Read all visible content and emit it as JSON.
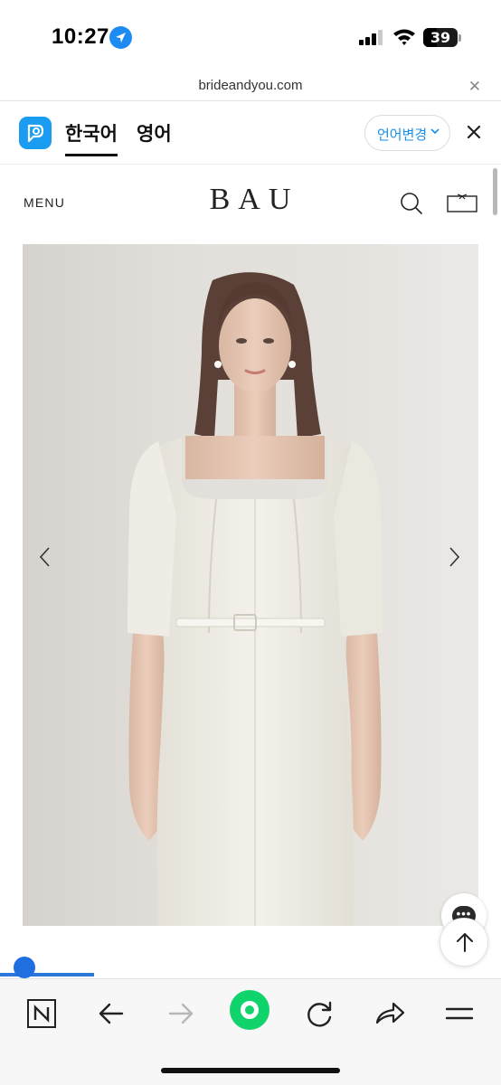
{
  "status_bar": {
    "time": "10:27",
    "battery": "39"
  },
  "browser": {
    "url": "brideandyou.com"
  },
  "translate_bar": {
    "tabs": [
      {
        "label": "한국어",
        "active": true
      },
      {
        "label": "영어",
        "active": false
      }
    ],
    "change_language_label": "언어변경"
  },
  "site": {
    "menu_label": "MENU",
    "brand": "BAU"
  },
  "product": {
    "image_description": "model wearing white square-neck belted midi dress"
  },
  "colors": {
    "accent_blue": "#1a8fe8",
    "papago_blue": "#1a9cf0",
    "naver_green": "#10d46b"
  },
  "icons": {
    "search": "search-icon",
    "bag": "shopping-bag-icon",
    "prev": "chevron-left-icon",
    "next": "chevron-right-icon",
    "chat": "chat-icon",
    "top": "arrow-up-icon"
  }
}
